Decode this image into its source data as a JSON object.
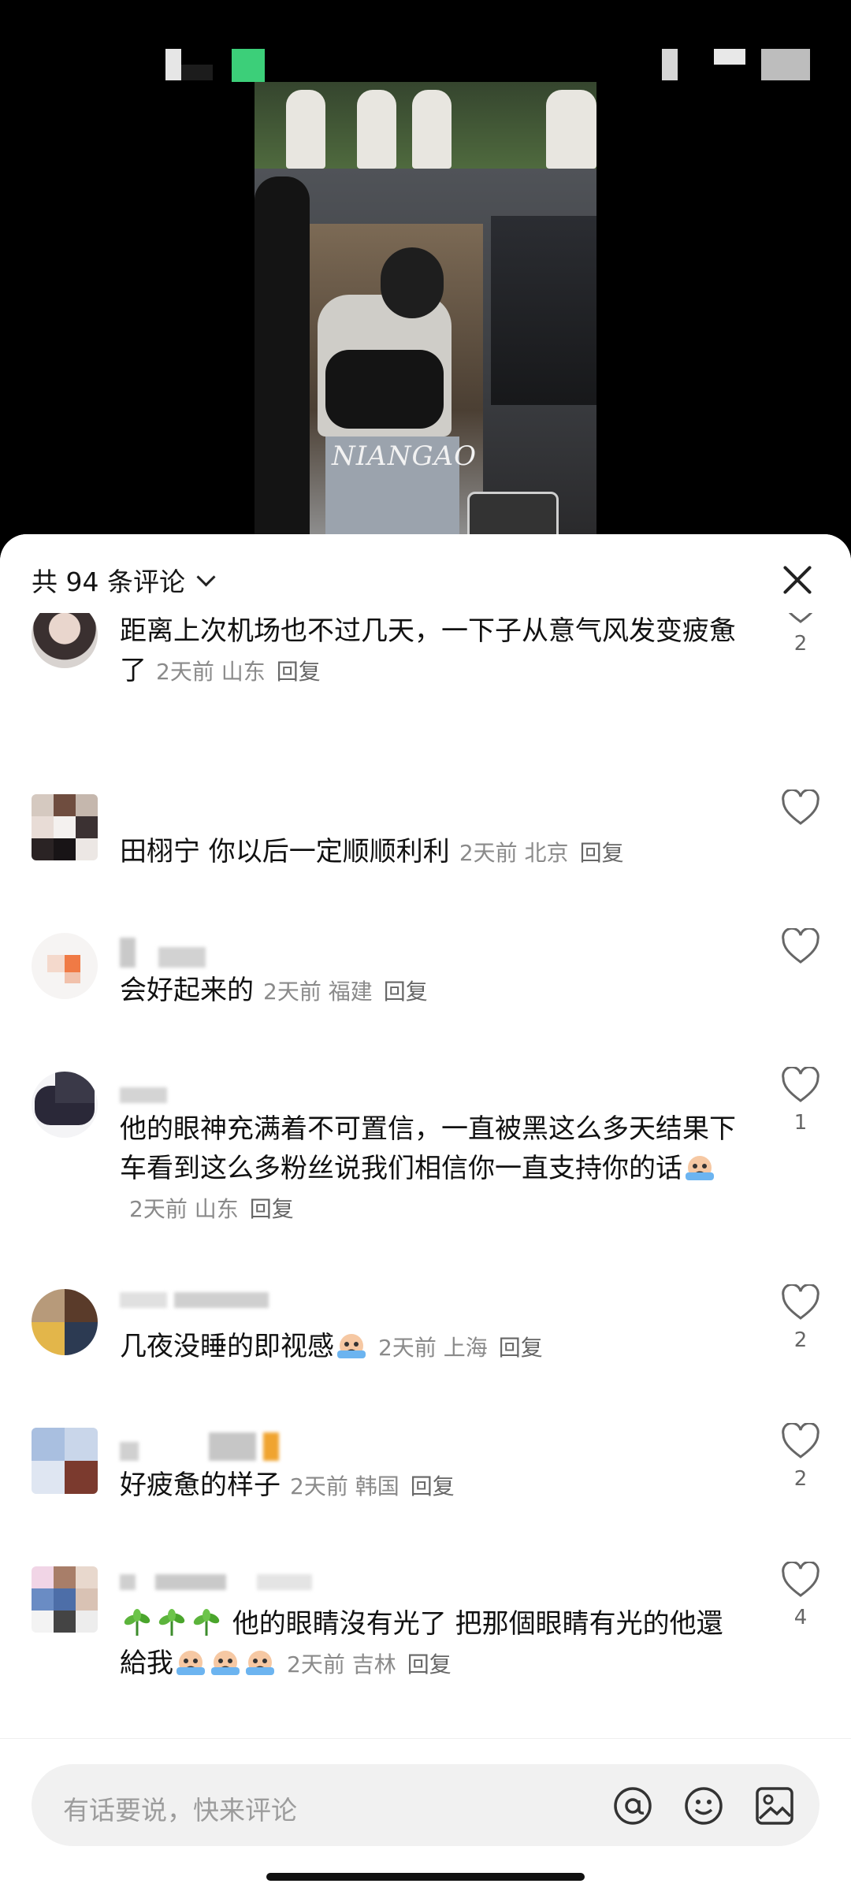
{
  "video": {
    "watermark": "NIANGAO"
  },
  "sheet": {
    "title": "共 94 条评论",
    "close_icon": "close-icon"
  },
  "comments": [
    {
      "text": "距离上次机场也不过几天，一下子从意气风发变疲惫了",
      "time": "2天前",
      "location": "山东",
      "reply": "回复",
      "likes": "2"
    },
    {
      "text": "田栩宁 你以后一定顺顺利利",
      "time": "2天前",
      "location": "北京",
      "reply": "回复",
      "likes": ""
    },
    {
      "text": "会好起来的",
      "time": "2天前",
      "location": "福建",
      "reply": "回复",
      "likes": ""
    },
    {
      "text": "他的眼神充满着不可置信，一直被黑这么多天结果下车看到这么多粉丝说我们相信你一直支持你的话",
      "time": "2天前",
      "location": "山东",
      "reply": "回复",
      "likes": "1"
    },
    {
      "text": "几夜没睡的即视感",
      "time": "2天前",
      "location": "上海",
      "reply": "回复",
      "likes": "2"
    },
    {
      "text": "好疲惫的样子",
      "time": "2天前",
      "location": "韩国",
      "reply": "回复",
      "likes": "2"
    },
    {
      "text": "他的眼睛沒有光了 把那個眼睛有光的他還給我",
      "time": "2天前",
      "location": "吉林",
      "reply": "回复",
      "likes": "4"
    }
  ],
  "input": {
    "placeholder": "有话要说，快来评论"
  },
  "colors": {
    "sheet_bg": "#ffffff",
    "meta": "#8a8a8a",
    "input_bg": "#f1f1f1"
  }
}
